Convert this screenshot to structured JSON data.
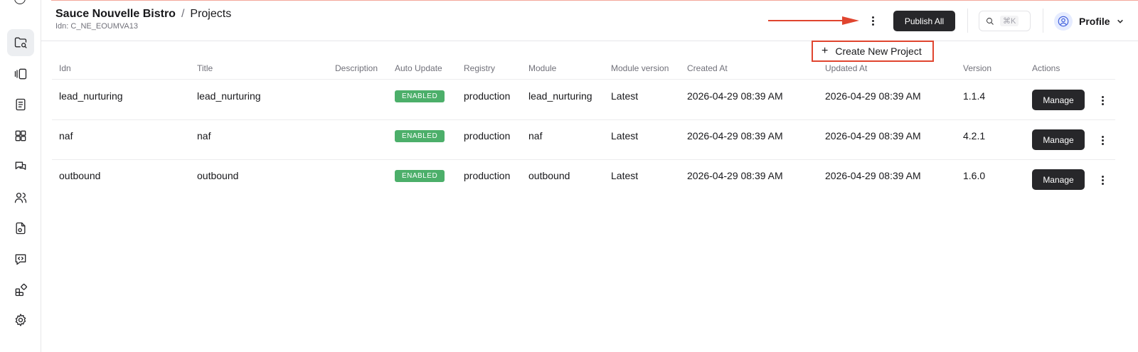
{
  "header": {
    "org_name": "Sauce Nouvelle Bistro",
    "separator": "/",
    "page_title": "Projects",
    "idn_label": "Idn: C_NE_EOUMVA13",
    "publish_label": "Publish All",
    "search_shortcut": "⌘K",
    "profile_label": "Profile"
  },
  "menu": {
    "create_plus": "+",
    "create_label": "Create New Project"
  },
  "sidebar": {
    "items": [
      {
        "icon": "folder-search-icon",
        "active": true
      },
      {
        "icon": "kanban-icon",
        "active": false
      },
      {
        "icon": "document-icon",
        "active": false
      },
      {
        "icon": "grid-icon",
        "active": false
      },
      {
        "icon": "chat-icon",
        "active": false
      },
      {
        "icon": "users-icon",
        "active": false
      },
      {
        "icon": "file-settings-icon",
        "active": false
      },
      {
        "icon": "code-chat-icon",
        "active": false
      },
      {
        "icon": "widgets-icon",
        "active": false
      },
      {
        "icon": "gear-icon",
        "active": false
      }
    ]
  },
  "table": {
    "columns": [
      "Idn",
      "Title",
      "Description",
      "Auto Update",
      "Registry",
      "Module",
      "Module version",
      "Created At",
      "Updated At",
      "Version",
      "Actions"
    ],
    "rows": [
      {
        "idn": "lead_nurturing",
        "title": "lead_nurturing",
        "description": "",
        "auto_update": "ENABLED",
        "registry": "production",
        "module": "lead_nurturing",
        "module_version": "Latest",
        "created_at": "2026-04-29 08:39 AM",
        "updated_at": "2026-04-29 08:39 AM",
        "version": "1.1.4",
        "action": "Manage"
      },
      {
        "idn": "naf",
        "title": "naf",
        "description": "",
        "auto_update": "ENABLED",
        "registry": "production",
        "module": "naf",
        "module_version": "Latest",
        "created_at": "2026-04-29 08:39 AM",
        "updated_at": "2026-04-29 08:39 AM",
        "version": "4.2.1",
        "action": "Manage"
      },
      {
        "idn": "outbound",
        "title": "outbound",
        "description": "",
        "auto_update": "ENABLED",
        "registry": "production",
        "module": "outbound",
        "module_version": "Latest",
        "created_at": "2026-04-29 08:39 AM",
        "updated_at": "2026-04-29 08:39 AM",
        "version": "1.6.0",
        "action": "Manage"
      }
    ]
  },
  "colors": {
    "accent_red": "#e0452f",
    "badge_green": "#4caf6a",
    "dark_button": "#27272a"
  }
}
